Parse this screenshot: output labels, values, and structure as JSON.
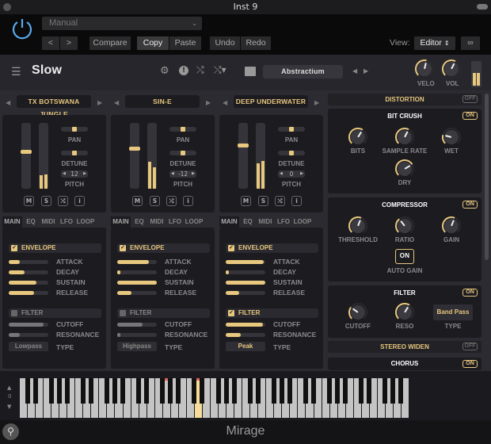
{
  "window": {
    "title": "Inst 9"
  },
  "host": {
    "preset_dropdown": "Manual",
    "prev": "<",
    "next": ">",
    "compare": "Compare",
    "copy": "Copy",
    "paste": "Paste",
    "undo": "Undo",
    "redo": "Redo",
    "view_label": "View:",
    "view_value": "Editor"
  },
  "plugin": {
    "preset_name": "Slow",
    "bank_name": "Abstractium",
    "velo_label": "VELO",
    "vol_label": "VOL",
    "velo_value": 0.55,
    "vol_value": 0.6,
    "output_meter": [
      0.55,
      0.55
    ],
    "accent": "#e8c77e"
  },
  "layers": [
    {
      "name": "TX BOTSWANA JUNGLE",
      "fader": 0.57,
      "meter": [
        0.2,
        0.22
      ],
      "pan": 0.5,
      "detune": 0.5,
      "pitch": "12",
      "envelope": {
        "enabled": true,
        "attack": 0.27,
        "decay": 0.4,
        "sustain": 0.7,
        "release": 0.63
      },
      "filter": {
        "enabled": false,
        "cutoff": 0.87,
        "resonance": 0.28,
        "type": "Lowpass"
      }
    },
    {
      "name": "SIN-E",
      "fader": 0.61,
      "meter": [
        0.41,
        0.32
      ],
      "pan": 0.5,
      "detune": 0.5,
      "pitch": "-12",
      "envelope": {
        "enabled": true,
        "attack": 0.8,
        "decay": 0.05,
        "sustain": 1.0,
        "release": 0.35
      },
      "filter": {
        "enabled": false,
        "cutoff": 0.63,
        "resonance": 0.05,
        "type": "Highpass"
      }
    },
    {
      "name": "DEEP UNDERWATER",
      "fader": 0.66,
      "meter": [
        0.38,
        0.42
      ],
      "pan": 0.5,
      "detune": 0.5,
      "pitch": "0",
      "envelope": {
        "enabled": true,
        "attack": 0.95,
        "decay": 0.05,
        "sustain": 1.0,
        "release": 0.33
      },
      "filter": {
        "enabled": true,
        "cutoff": 0.93,
        "resonance": 0.37,
        "type": "Peak"
      }
    }
  ],
  "layer_labels": {
    "pan": "PAN",
    "detune": "DETUNE",
    "pitch": "PITCH",
    "mute": "M",
    "solo": "S",
    "info": "i",
    "tabs": [
      "MAIN",
      "EQ",
      "MIDI",
      "LFO",
      "LOOP"
    ],
    "envelope": "ENVELOPE",
    "attack": "ATTACK",
    "decay": "DECAY",
    "sustain": "SUSTAIN",
    "release": "RELEASE",
    "filter": "FILTER",
    "cutoff": "CUTOFF",
    "resonance": "RESONANCE",
    "type": "TYPE"
  },
  "effects": {
    "distortion": {
      "title": "DISTORTION",
      "state": "OFF"
    },
    "bitcrush": {
      "title": "BIT CRUSH",
      "state": "ON",
      "knobs": [
        {
          "label": "BITS",
          "value": 0.62
        },
        {
          "label": "SAMPLE RATE",
          "value": 0.6
        },
        {
          "label": "WET",
          "value": 0.22
        },
        {
          "label": "DRY",
          "value": 0.72
        }
      ]
    },
    "compressor": {
      "title": "COMPRESSOR",
      "state": "ON",
      "knobs": [
        {
          "label": "THRESHOLD",
          "value": 0.58
        },
        {
          "label": "RATIO",
          "value": 0.36
        },
        {
          "label": "GAIN",
          "value": 0.58
        }
      ],
      "auto_gain_label": "AUTO GAIN",
      "auto_gain_state": "ON"
    },
    "filter": {
      "title": "FILTER",
      "state": "ON",
      "knobs": [
        {
          "label": "CUTOFF",
          "value": 0.3
        },
        {
          "label": "RESO",
          "value": 0.62
        }
      ],
      "type_label": "TYPE",
      "type_value": "Band Pass"
    },
    "stereo_widen": {
      "title": "STEREO WIDEN",
      "state": "OFF"
    },
    "chorus": {
      "title": "CHORUS",
      "state": "ON"
    }
  },
  "keyboard": {
    "octave": "0",
    "white_keys": 49,
    "pressed_white_key": 22,
    "played_markers": [
      18,
      22
    ]
  },
  "footer": {
    "title": "Mirage"
  }
}
